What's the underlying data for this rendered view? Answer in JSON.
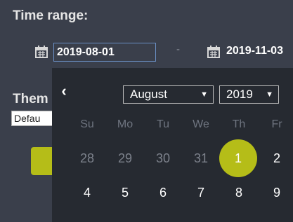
{
  "time_range": {
    "title": "Time range:",
    "start_icon": "calendar-icon",
    "start_value": "2019-08-01",
    "separator": "-",
    "end_icon": "calendar-icon",
    "end_value": "2019-11-03"
  },
  "theme": {
    "label": "Them",
    "selected": "Defau"
  },
  "datepicker": {
    "prev_icon": "chevron-left-icon",
    "month": "August",
    "year": "2019",
    "weekdays": [
      "Su",
      "Mo",
      "Tu",
      "We",
      "Th",
      "Fr"
    ],
    "week1": [
      "28",
      "29",
      "30",
      "31",
      "1",
      "2"
    ],
    "week2": [
      "4",
      "5",
      "6",
      "7",
      "8",
      "9"
    ],
    "selected_day": "1",
    "accent_color": "#b5bd18"
  }
}
